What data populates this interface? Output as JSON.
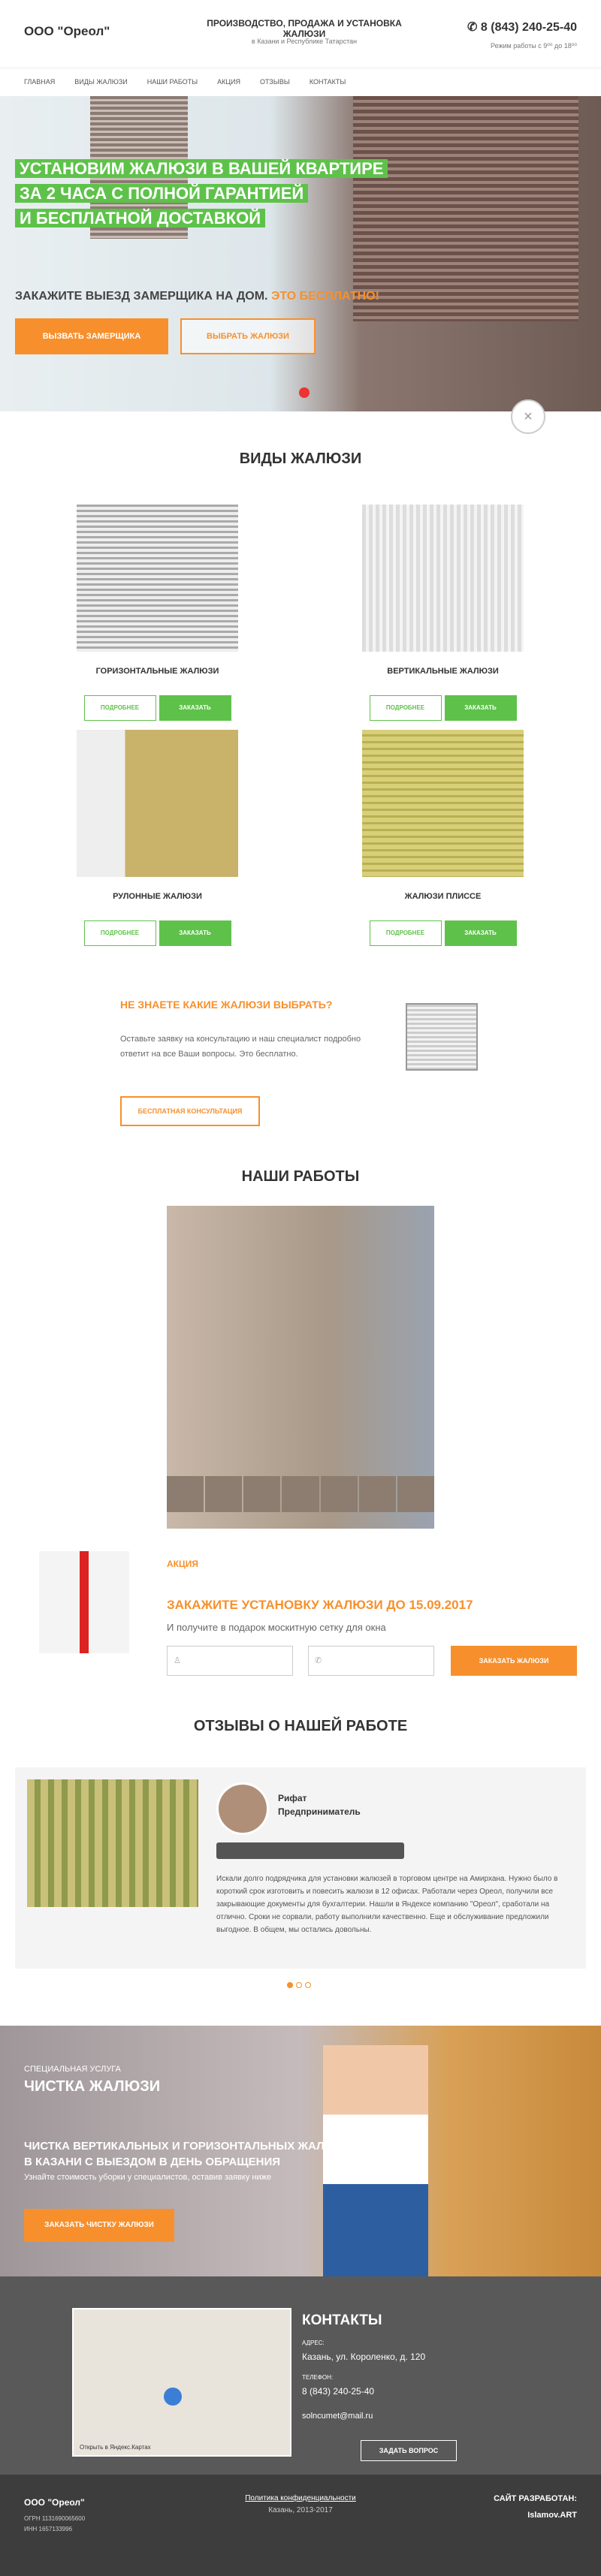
{
  "header": {
    "logo": "ООО \"Ореол\"",
    "tagline": "ПРОИЗВОДСТВО, ПРОДАЖА И УСТАНОВКА ЖАЛЮЗИ",
    "region": "в Казани и Республике Татарстан",
    "phone": "8 (843) 240-25-40",
    "hours": "Режим работы с 9⁰⁰ до 18⁰⁰"
  },
  "nav": [
    "ГЛАВНАЯ",
    "ВИДЫ ЖАЛЮЗИ",
    "НАШИ РАБОТЫ",
    "АКЦИЯ",
    "ОТЗЫВЫ",
    "КОНТАКТЫ"
  ],
  "hero": {
    "line1": "УСТАНОВИМ ЖАЛЮЗИ В ВАШЕЙ КВАРТИРЕ",
    "line2": "ЗА 2 ЧАСА С ПОЛНОЙ ГАРАНТИЕЙ",
    "line3": "И БЕСПЛАТНОЙ ДОСТАВКОЙ",
    "sub": "ЗАКАЖИТЕ ВЫЕЗД ЗАМЕРЩИКА НА ДОМ.",
    "sub_hl": "ЭТО БЕСПЛАТНО!",
    "btn1": "ВЫЗВАТЬ ЗАМЕРЩИКА",
    "btn2": "ВЫБРАТЬ ЖАЛЮЗИ",
    "close": "×"
  },
  "types": {
    "title": "ВИДЫ ЖАЛЮЗИ",
    "more": "ПОДРОБНЕЕ",
    "order": "ЗАКАЗАТЬ",
    "items": [
      "ГОРИЗОНТАЛЬНЫЕ ЖАЛЮЗИ",
      "ВЕРТИКАЛЬНЫЕ ЖАЛЮЗИ",
      "РУЛОННЫЕ ЖАЛЮЗИ",
      "ЖАЛЮЗИ ПЛИССЕ"
    ]
  },
  "consult": {
    "title": "НЕ ЗНАЕТЕ КАКИЕ ЖАЛЮЗИ ВЫБРАТЬ?",
    "text": "Оставьте заявку на консультацию и наш специалист подробно ответит на все Ваши вопросы. Это бесплатно.",
    "btn": "БЕСПЛАТНАЯ КОНСУЛЬТАЦИЯ"
  },
  "works": {
    "title": "НАШИ РАБОТЫ"
  },
  "promo": {
    "label": "АКЦИЯ",
    "title": "ЗАКАЖИТЕ УСТАНОВКУ ЖАЛЮЗИ ДО 15.09.2017",
    "sub": "И получите в подарок москитную сетку для окна",
    "btn": "ЗАКАЗАТЬ ЖАЛЮЗИ"
  },
  "reviews": {
    "title": "ОТЗЫВЫ О НАШЕЙ РАБОТЕ",
    "name": "Рифат",
    "role": "Предприниматель",
    "text": "Искали долго подрядчика для установки жалюзей в торговом центре на Амирхана. Нужно было в короткий срок изготовить и повесить жалюзи в 12 офисах. Работали через Ореол, получили все закрывающие документы для бухгалтерии. Нашли в Яндексе компанию \"Ореол\", сработали на отлично. Сроки не сорвали, работу выполнили качественно. Еще и обслуживание предложили выгодное. В общем, мы остались довольны."
  },
  "service": {
    "small": "СПЕЦИАЛЬНАЯ УСЛУГА",
    "big": "ЧИСТКА ЖАЛЮЗИ",
    "h1": "ЧИСТКА ВЕРТИКАЛЬНЫХ И ГОРИЗОНТАЛЬНЫХ ЖАЛЮЗИ",
    "h2": "В КАЗАНИ С ВЫЕЗДОМ В ДЕНЬ ОБРАЩЕНИЯ",
    "text": "Узнайте стоимость уборки у специалистов, оставив заявку ниже",
    "btn": "ЗАКАЗАТЬ ЧИСТКУ ЖАЛЮЗИ"
  },
  "contacts": {
    "title": "КОНТАКТЫ",
    "addr_l": "АДРЕС:",
    "addr": "Казань, ул. Короленко, д. 120",
    "tel_l": "ТЕЛЕФОН:",
    "tel": "8 (843) 240-25-40",
    "email": "solncumet@mail.ru",
    "btn": "ЗАДАТЬ ВОПРОС",
    "map_link": "Открыть в Яндекс.Картах"
  },
  "footer": {
    "company": "ООО \"Ореол\"",
    "ogrn": "ОГРН 1131690065600",
    "inn": "ИНН 1657133996",
    "policy": "Политика конфиденциальности",
    "copy": "Казань, 2013-2017",
    "dev_l": "САЙТ РАЗРАБОТАН:",
    "dev": "Islamov.ART"
  }
}
